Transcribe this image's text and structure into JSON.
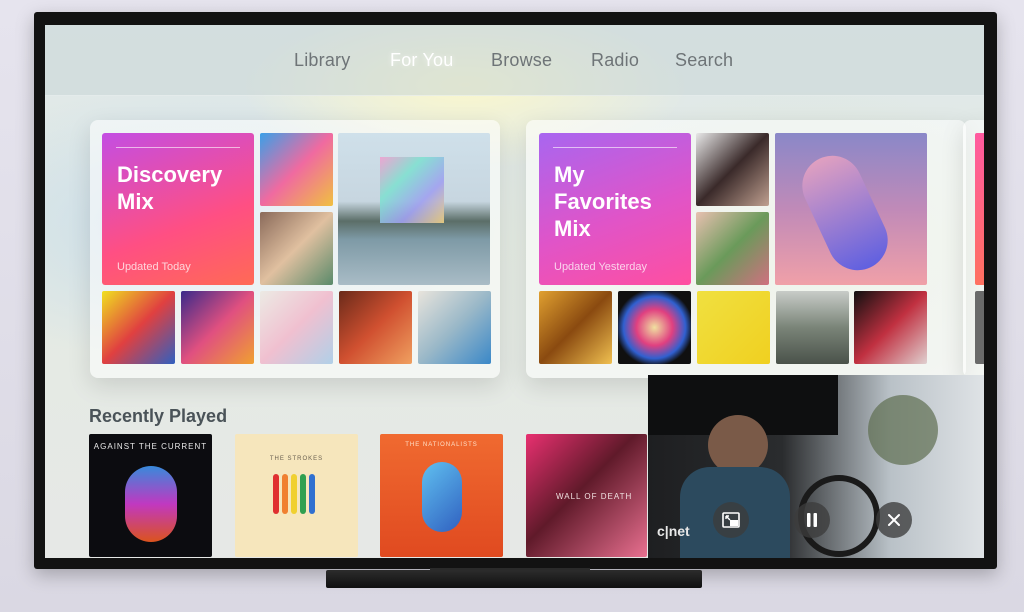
{
  "nav": {
    "items": [
      {
        "label": "Library"
      },
      {
        "label": "For You"
      },
      {
        "label": "Browse"
      },
      {
        "label": "Radio"
      },
      {
        "label": "Search"
      }
    ],
    "active": "For You"
  },
  "mixes": [
    {
      "title": "Discovery\nMix",
      "updated": "Updated Today",
      "gradient": [
        "#c450e0",
        "#ff5a6a"
      ]
    },
    {
      "title": "My\nFavorites\nMix",
      "updated": "Updated Yesterday",
      "gradient": [
        "#a866f0",
        "#ff4fa8"
      ]
    }
  ],
  "recently_played": {
    "title": "Recently Played",
    "items": [
      {
        "art_text": "AGAINST THE CURRENT"
      },
      {
        "art_text": "THE STROKES"
      },
      {
        "art_text": "THE NATIONALISTS"
      },
      {
        "art_text": "WALL OF DEATH"
      }
    ]
  },
  "pip": {
    "watermark": "c|net",
    "controls": [
      "restore-window-icon",
      "pause-icon",
      "close-icon"
    ]
  },
  "colors": {
    "active_nav": "#ffffff",
    "inactive_nav": "#6e7477"
  }
}
